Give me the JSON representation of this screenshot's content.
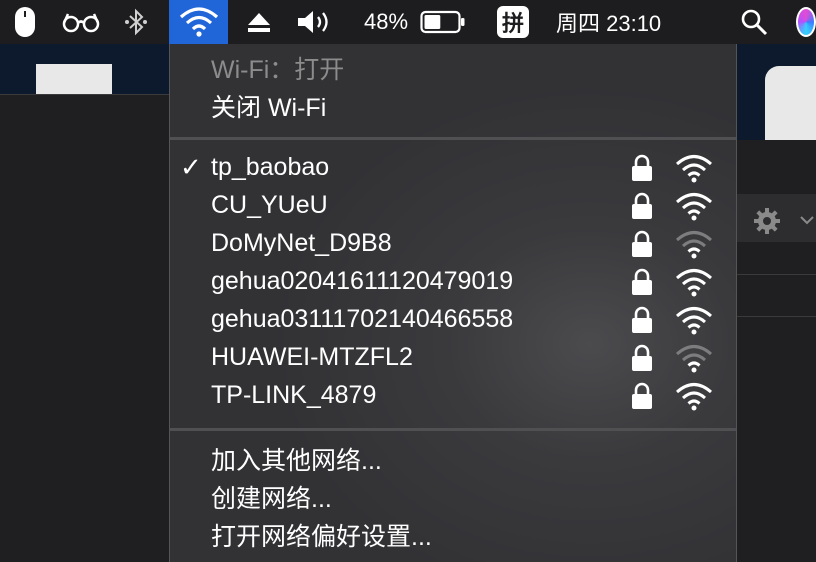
{
  "menubar": {
    "battery_percent": "48%",
    "input_method": "拼",
    "datetime": "周四 23:10",
    "battery_level": 0.48
  },
  "wifi_menu": {
    "status": "Wi-Fi：打开",
    "toggle_label": "关闭 Wi-Fi",
    "networks": [
      {
        "name": "tp_baobao",
        "connected": true,
        "locked": true,
        "signal": 3
      },
      {
        "name": "CU_YUeU",
        "connected": false,
        "locked": true,
        "signal": 3
      },
      {
        "name": "DoMyNet_D9B8",
        "connected": false,
        "locked": true,
        "signal": 1
      },
      {
        "name": "gehua02041611120479019",
        "connected": false,
        "locked": true,
        "signal": 3
      },
      {
        "name": "gehua03111702140466558",
        "connected": false,
        "locked": true,
        "signal": 3
      },
      {
        "name": "HUAWEI-MTZFL2",
        "connected": false,
        "locked": true,
        "signal": 1
      },
      {
        "name": "TP-LINK_4879",
        "connected": false,
        "locked": true,
        "signal": 3
      }
    ],
    "join_other": "加入其他网络...",
    "create_network": "创建网络...",
    "open_prefs": "打开网络偏好设置..."
  },
  "colors": {
    "menubar_bg": "#1d1d1f",
    "active_highlight": "#2166d9",
    "menu_bg": "#3a3a3d"
  }
}
